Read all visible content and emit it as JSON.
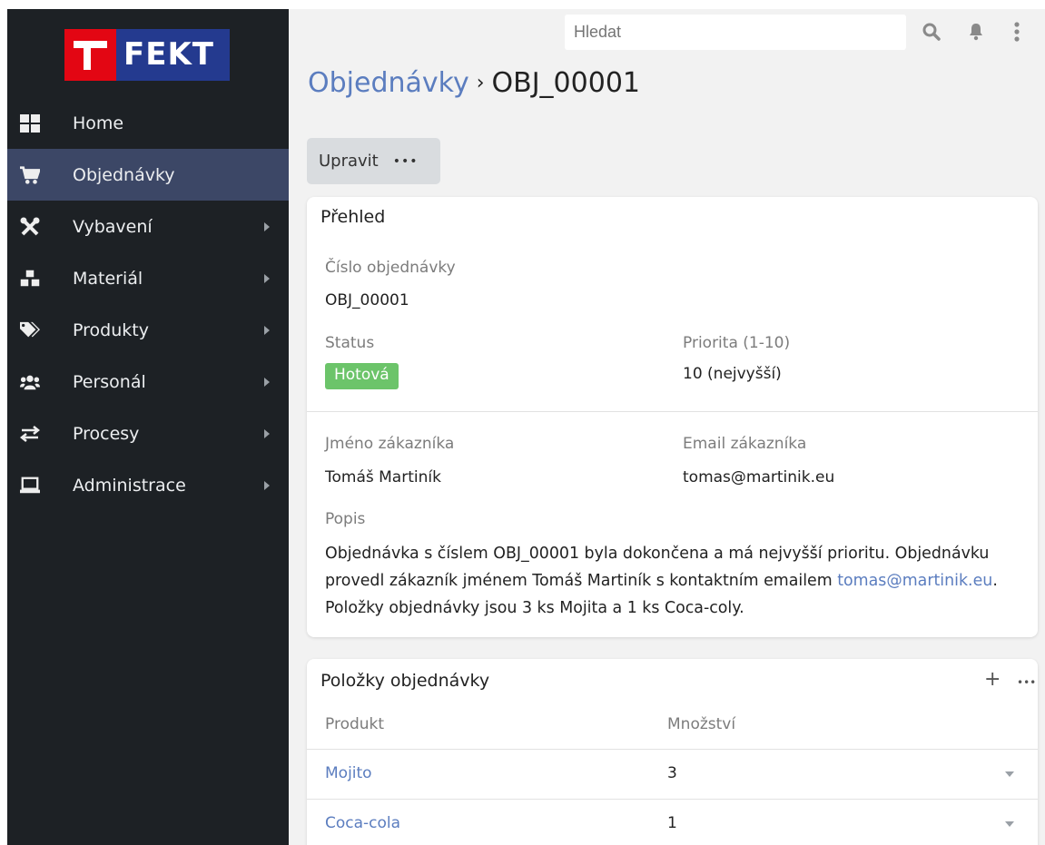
{
  "logo": {
    "text": "FEKT"
  },
  "sidebar": {
    "items": [
      {
        "label": "Home",
        "icon": "grid-icon",
        "has_submenu": false,
        "active": false
      },
      {
        "label": "Objednávky",
        "icon": "cart-icon",
        "has_submenu": false,
        "active": true
      },
      {
        "label": "Vybavení",
        "icon": "tools-icon",
        "has_submenu": true,
        "active": false
      },
      {
        "label": "Materiál",
        "icon": "cubes-icon",
        "has_submenu": true,
        "active": false
      },
      {
        "label": "Produkty",
        "icon": "tags-icon",
        "has_submenu": true,
        "active": false
      },
      {
        "label": "Personál",
        "icon": "users-icon",
        "has_submenu": true,
        "active": false
      },
      {
        "label": "Procesy",
        "icon": "exchange-icon",
        "has_submenu": true,
        "active": false
      },
      {
        "label": "Administrace",
        "icon": "laptop-icon",
        "has_submenu": true,
        "active": false
      }
    ]
  },
  "search": {
    "placeholder": "Hledat"
  },
  "topbar": {
    "icons": [
      "search-icon",
      "bell-icon",
      "kebab-menu-icon"
    ]
  },
  "breadcrumb": {
    "parent": "Objednávky",
    "separator": "›",
    "current": "OBJ_00001"
  },
  "toolbar": {
    "edit_label": "Upravit",
    "more_label": "•••"
  },
  "overview": {
    "title": "Přehled",
    "order_number_label": "Číslo objednávky",
    "order_number": "OBJ_00001",
    "status_label": "Status",
    "status": "Hotová",
    "priority_label": "Priorita (1-10)",
    "priority": "10 (nejvyšší)",
    "customer_name_label": "Jméno zákazníka",
    "customer_name": "Tomáš Martiník",
    "customer_email_label": "Email zákazníka",
    "customer_email": "tomas@martinik.eu",
    "description_label": "Popis",
    "description_part1": "Objednávka s číslem OBJ_00001 byla dokončena a má nejvyšší prioritu. Objednávku provedl zákazník jménem Tomáš Martiník s kontaktním emailem ",
    "description_link": "tomas@martinik.eu",
    "description_part2": ". Položky objednávky jsou 3 ks Mojita a 1 ks Coca-coly."
  },
  "items_card": {
    "title": "Položky objednávky",
    "add_label": "+",
    "more_label": "•••",
    "columns": [
      "Produkt",
      "Množství"
    ],
    "rows": [
      {
        "product": "Mojito",
        "quantity": "3"
      },
      {
        "product": "Coca-cola",
        "quantity": "1"
      }
    ]
  },
  "colors": {
    "sidebar_bg": "#1d2125",
    "sidebar_active": "#3c4766",
    "link": "#5b7dbf",
    "status_green": "#6cc46a",
    "logo_red": "#e30613",
    "logo_blue": "#243a8f"
  }
}
